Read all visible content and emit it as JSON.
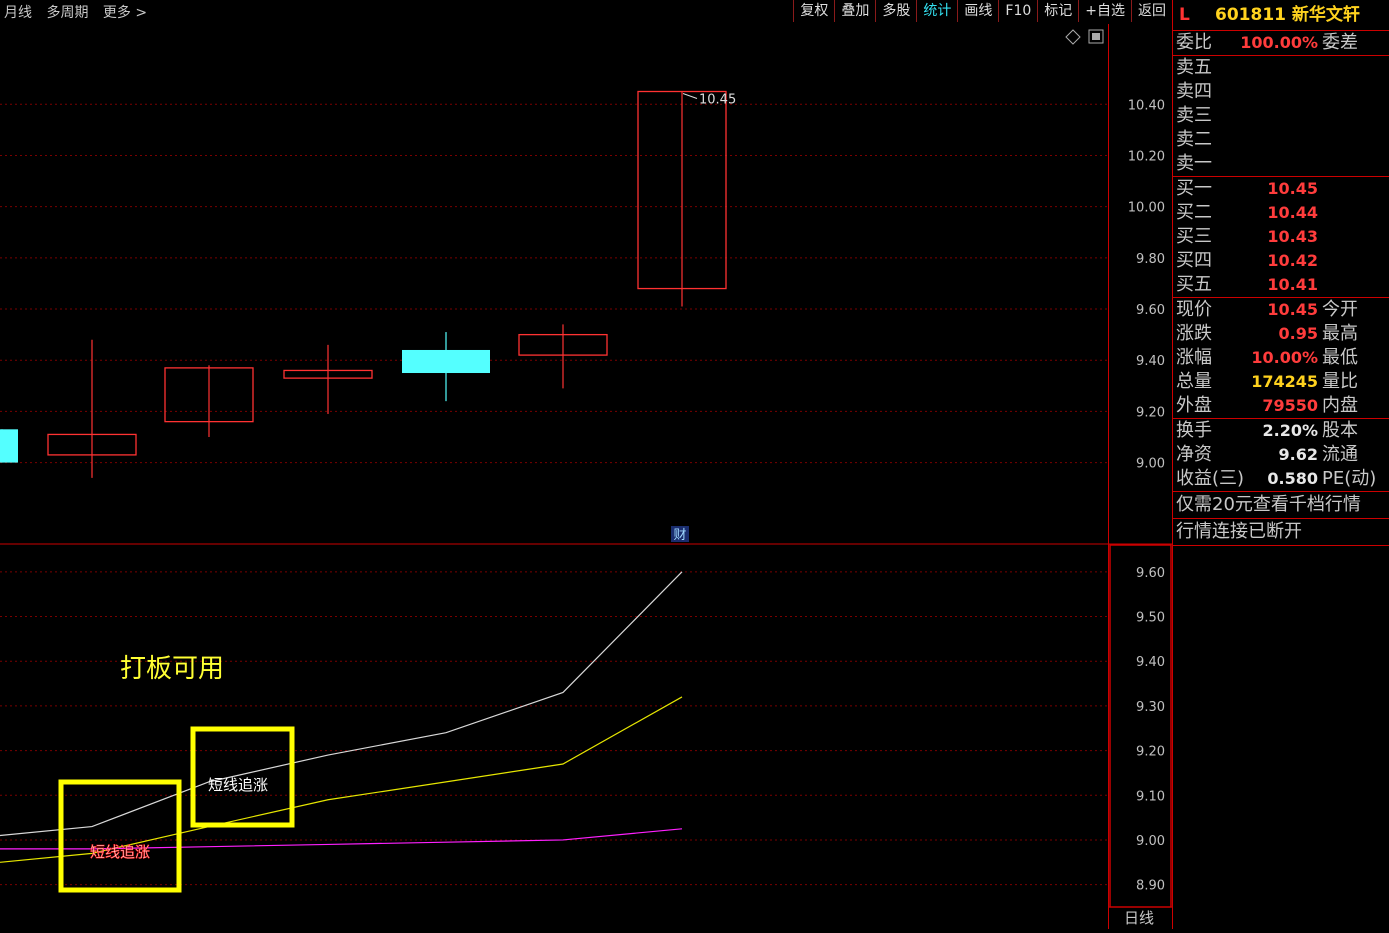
{
  "toolbar": {
    "left": [
      "月线",
      "多周期",
      "更多 >"
    ],
    "buttons": [
      "复权",
      "叠加",
      "多股",
      "统计",
      "画线",
      "F10",
      "标记",
      "+自选",
      "返回"
    ],
    "active_button": "统计"
  },
  "stock": {
    "flag": "L",
    "code": "601811",
    "name": "新华文轩"
  },
  "quote": {
    "weibi_label": "委比",
    "weibi_value": "100.00%",
    "weicha_label": "委差",
    "asks": [
      {
        "label": "卖五",
        "value": ""
      },
      {
        "label": "卖四",
        "value": ""
      },
      {
        "label": "卖三",
        "value": ""
      },
      {
        "label": "卖二",
        "value": ""
      },
      {
        "label": "卖一",
        "value": ""
      }
    ],
    "bids": [
      {
        "label": "买一",
        "value": "10.45"
      },
      {
        "label": "买二",
        "value": "10.44"
      },
      {
        "label": "买三",
        "value": "10.43"
      },
      {
        "label": "买四",
        "value": "10.42"
      },
      {
        "label": "买五",
        "value": "10.41"
      }
    ],
    "stats": [
      {
        "label": "现价",
        "value": "10.45",
        "label2": "今开",
        "color": "#ff3c3c"
      },
      {
        "label": "涨跌",
        "value": "0.95",
        "label2": "最高",
        "color": "#ff3c3c"
      },
      {
        "label": "涨幅",
        "value": "10.00%",
        "label2": "最低",
        "color": "#ff3c3c"
      },
      {
        "label": "总量",
        "value": "174245",
        "label2": "量比",
        "color": "#ffd21e"
      },
      {
        "label": "外盘",
        "value": "79550",
        "label2": "内盘",
        "color": "#ff3c3c"
      }
    ],
    "stats2": [
      {
        "label": "换手",
        "value": "2.20%",
        "label2": "股本",
        "color": "#e8e8e8"
      },
      {
        "label": "净资",
        "value": "9.62",
        "label2": "流通",
        "color": "#e8e8e8"
      },
      {
        "label": "收益(三)",
        "value": "0.580",
        "label2": "PE(动)",
        "color": "#e8e8e8"
      }
    ],
    "notes": [
      "仅需20元查看千档行情",
      "行情连接已断开"
    ]
  },
  "colors": {
    "up": "#ff3232",
    "down": "#54ffff",
    "grid": "#7a0000",
    "axis_text": "#c0c0c0"
  },
  "annotations": {
    "high_label": "10.45",
    "fin_marker": "财",
    "dbky": "打板可用",
    "box1": "短线追涨",
    "box2": "短线追涨",
    "period": "日线"
  },
  "chart_data": [
    {
      "type": "candlestick",
      "ylim": [
        8.76,
        10.62
      ],
      "yticks": [
        "10.40",
        "10.20",
        "10.00",
        "9.80",
        "9.60",
        "9.40",
        "9.20",
        "9.00"
      ],
      "candles": [
        {
          "open": 9.13,
          "close": 9.0,
          "high": 9.13,
          "low": 9.0
        },
        {
          "open": 9.03,
          "close": 9.11,
          "high": 9.48,
          "low": 8.94
        },
        {
          "open": 9.16,
          "close": 9.37,
          "high": 9.38,
          "low": 9.1
        },
        {
          "open": 9.33,
          "close": 9.36,
          "high": 9.46,
          "low": 9.19
        },
        {
          "open": 9.44,
          "close": 9.35,
          "high": 9.51,
          "low": 9.24
        },
        {
          "open": 9.42,
          "close": 9.5,
          "high": 9.54,
          "low": 9.29
        },
        {
          "open": 9.68,
          "close": 10.45,
          "high": 10.45,
          "low": 9.61
        }
      ]
    },
    {
      "type": "line",
      "ylim": [
        8.85,
        9.66
      ],
      "yticks": [
        "9.60",
        "9.50",
        "9.40",
        "9.30",
        "9.20",
        "9.10",
        "9.00",
        "8.90"
      ],
      "series": [
        {
          "color": "#d8d8d8",
          "values": [
            9.01,
            9.03,
            9.13,
            9.19,
            9.24,
            9.33,
            9.6
          ]
        },
        {
          "color": "#e6e600",
          "values": [
            8.95,
            8.97,
            9.03,
            9.09,
            9.13,
            9.17,
            9.32
          ]
        },
        {
          "color": "#ff20ff",
          "values": [
            8.98,
            8.98,
            8.985,
            8.99,
            8.995,
            9.0,
            9.025
          ]
        }
      ]
    }
  ]
}
